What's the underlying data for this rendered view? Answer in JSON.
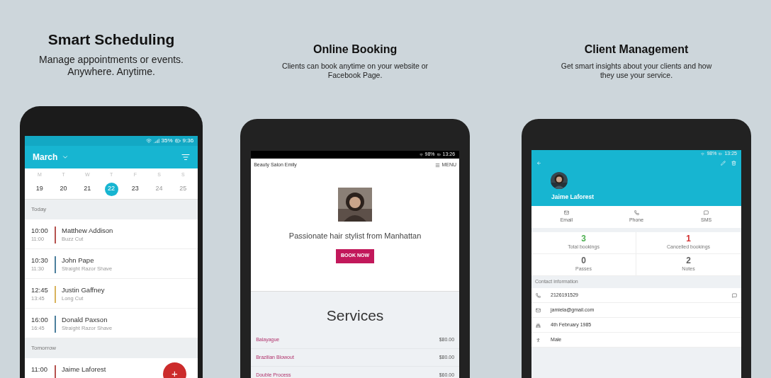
{
  "scheduling": {
    "headline": "Smart Scheduling",
    "tagline": "Manage appointments or events. Anywhere. Anytime.",
    "status": {
      "battery": "35%",
      "time": "9:36"
    },
    "month": "March",
    "days": [
      {
        "letter": "M",
        "date": "19",
        "selected": false,
        "dimmed": false
      },
      {
        "letter": "T",
        "date": "20",
        "selected": false,
        "dimmed": false
      },
      {
        "letter": "W",
        "date": "21",
        "selected": false,
        "dimmed": false
      },
      {
        "letter": "T",
        "date": "22",
        "selected": true,
        "dimmed": false
      },
      {
        "letter": "F",
        "date": "23",
        "selected": false,
        "dimmed": false
      },
      {
        "letter": "S",
        "date": "24",
        "selected": false,
        "dimmed": true
      },
      {
        "letter": "S",
        "date": "25",
        "selected": false,
        "dimmed": true
      }
    ],
    "sections": [
      {
        "label": "Today",
        "appointments": [
          {
            "start": "10:00",
            "end": "11:00",
            "client": "Matthew Addison",
            "service": "Buzz Cut",
            "color": "#b5524f"
          },
          {
            "start": "10:30",
            "end": "11:30",
            "client": "John Pape",
            "service": "Straight Razor Shave",
            "color": "#4c7f9c"
          },
          {
            "start": "12:45",
            "end": "13:45",
            "client": "Justin Gaffney",
            "service": "Long Cut",
            "color": "#d8b35c"
          },
          {
            "start": "16:00",
            "end": "16:45",
            "client": "Donald Paxson",
            "service": "Straight Razor Shave",
            "color": "#4c7f9c"
          }
        ]
      },
      {
        "label": "Tomorrow",
        "appointments": [
          {
            "start": "11:00",
            "client": "Jaime Laforest",
            "color": "#b5524f"
          }
        ]
      }
    ],
    "fab": "+"
  },
  "booking": {
    "headline": "Online Booking",
    "tagline": "Clients can book anytime on your website or Facebook Page.",
    "status": {
      "battery": "98%",
      "time": "13:26"
    },
    "site_name": "Beauty Salon Emily",
    "menu": "MENU",
    "bio": "Passionate hair stylist from Manhattan",
    "button": "BOOK NOW",
    "services_title": "Services",
    "services": [
      {
        "name": "Balayague",
        "price": "$80.00"
      },
      {
        "name": "Brazilian Blowout",
        "price": "$80.00"
      },
      {
        "name": "Double Process",
        "price": "$60.00"
      }
    ]
  },
  "clients": {
    "headline": "Client Management",
    "tagline": "Get smart insights about your clients and how they use your service.",
    "status": {
      "battery": "98%",
      "time": "13:25"
    },
    "name": "Jaime Laforest",
    "actions": [
      {
        "kind": "email",
        "label": "Email"
      },
      {
        "kind": "phone",
        "label": "Phone"
      },
      {
        "kind": "sms",
        "label": "SMS"
      }
    ],
    "stats": [
      {
        "value": "3",
        "label": "Total bookings",
        "color": "#4caf50"
      },
      {
        "value": "1",
        "label": "Cancelled bookings",
        "color": "#d32f2f"
      },
      {
        "value": "0",
        "label": "Passes",
        "color": "#616161"
      },
      {
        "value": "2",
        "label": "Notes",
        "color": "#616161"
      }
    ],
    "contact_title": "Contact information",
    "contacts": [
      {
        "kind": "phone",
        "value": "2126191529"
      },
      {
        "kind": "email",
        "value": "jamiela@gmail.com"
      },
      {
        "kind": "birthday",
        "value": "4th February 1985"
      },
      {
        "kind": "gender",
        "value": "Male"
      }
    ]
  }
}
